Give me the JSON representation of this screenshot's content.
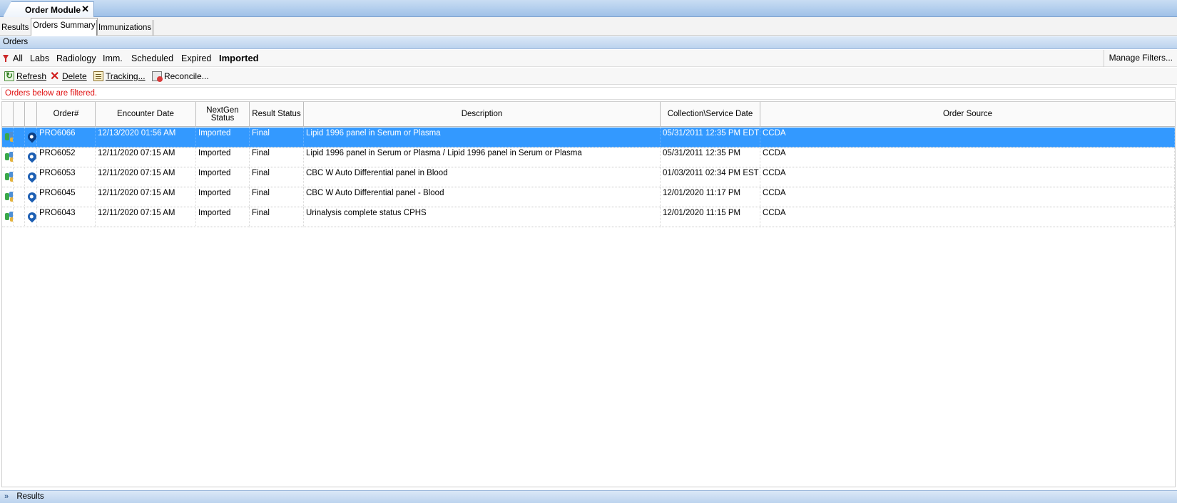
{
  "window": {
    "tab_title": "Order Module",
    "close_glyph": "✕"
  },
  "subtabs": [
    "Results",
    "Orders Summary",
    "Immunizations"
  ],
  "section_title": "Orders",
  "filters": {
    "items": [
      "All",
      "Labs",
      "Radiology",
      "Imm.",
      "Scheduled",
      "Expired",
      "Imported"
    ],
    "active": "Imported",
    "manage_label": "Manage Filters..."
  },
  "toolbar": {
    "refresh": "Refresh",
    "delete": "Delete",
    "tracking": "Tracking...",
    "reconcile": "Reconcile..."
  },
  "notice": "Orders below are filtered.",
  "table": {
    "headers": {
      "order": "Order#",
      "encounter_date": "Encounter Date",
      "nextgen_status_line1": "NextGen",
      "nextgen_status_line2": "Status",
      "result_status": "Result Status",
      "description": "Description",
      "collection_date": "Collection\\Service Date",
      "order_source": "Order Source"
    },
    "rows": [
      {
        "order": "PRO6066",
        "encounter_date": "12/13/2020 01:56 AM",
        "nextgen_status": "Imported",
        "result_status": "Final",
        "description": "Lipid 1996 panel in Serum or Plasma",
        "collection_date": "05/31/2011 12:35 PM EDT",
        "order_source": "CCDA",
        "selected": true
      },
      {
        "order": "PRO6052",
        "encounter_date": "12/11/2020 07:15 AM",
        "nextgen_status": "Imported",
        "result_status": "Final",
        "description": "Lipid 1996 panel in Serum or Plasma / Lipid 1996 panel in Serum or Plasma",
        "collection_date": "05/31/2011 12:35 PM",
        "order_source": "CCDA",
        "selected": false
      },
      {
        "order": "PRO6053",
        "encounter_date": "12/11/2020 07:15 AM",
        "nextgen_status": "Imported",
        "result_status": "Final",
        "description": "CBC W Auto Differential panel in Blood",
        "collection_date": "01/03/2011 02:34 PM EST",
        "order_source": "CCDA",
        "selected": false
      },
      {
        "order": "PRO6045",
        "encounter_date": "12/11/2020 07:15 AM",
        "nextgen_status": "Imported",
        "result_status": "Final",
        "description": "CBC W Auto Differential panel - Blood",
        "collection_date": "12/01/2020 11:17 PM",
        "order_source": "CCDA",
        "selected": false
      },
      {
        "order": "PRO6043",
        "encounter_date": "12/11/2020 07:15 AM",
        "nextgen_status": "Imported",
        "result_status": "Final",
        "description": "Urinalysis complete status CPHS",
        "collection_date": "12/01/2020 11:15 PM",
        "order_source": "CCDA",
        "selected": false
      }
    ]
  },
  "bottom_panel": {
    "label": "Results",
    "chevron_glyph": "»"
  },
  "colors": {
    "selection": "#3399ff",
    "notice_text": "#e01010",
    "header_gradient": "#bcd3ee"
  }
}
